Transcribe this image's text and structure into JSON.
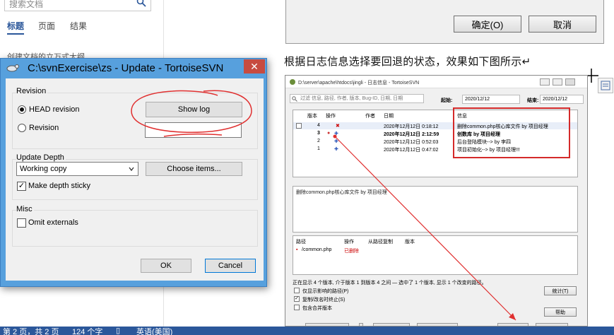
{
  "nav": {
    "search_placeholder": "搜索文档",
    "tabs": [
      "标题",
      "页面",
      "结果"
    ],
    "outline_item": "创建文档的立万式大纲"
  },
  "doc": {
    "confirm_label": "确定(O)",
    "cancel_label": "取消",
    "body_text": "根据日志信息选择要回退的状态，效果如下图所示↵"
  },
  "logshot": {
    "title": "D:\\server\\apache\\htdocs\\jingli - 日志信息 - TortoiseSVN",
    "filter_placeholder": "过滤 信息, 路径, 作者, 版本, Bug-ID, 日期, 日期",
    "from_label": "起始:",
    "from_value": "2020/12/12",
    "to_label": "结束:",
    "to_value": "2020/12/12",
    "columns": [
      "版本",
      "操作",
      "作者",
      "日期",
      "信息"
    ],
    "rows": [
      {
        "rev": "4",
        "date": "2020年12月12日 0:18:12",
        "msg": "删除common.php核心库文件 by 项目经理",
        "bold": false
      },
      {
        "rev": "3",
        "date": "2020年12月12日 2:12:59",
        "msg": "创数库 by 项目经理",
        "bold": true
      },
      {
        "rev": "2",
        "date": "2020年12月12日 0:52:03",
        "msg": "后台登陆模块--> by 李四",
        "bold": false
      },
      {
        "rev": "1",
        "date": "2020年12月12日 0:47:02",
        "msg": "项目初始化--> by 项目经理!!!",
        "bold": false
      }
    ],
    "detail_text": "删除common.php核心库文件  by  项目经理",
    "path_columns": [
      "路径",
      "操作",
      "从路径复制",
      "版本"
    ],
    "path_row": {
      "path": "/common.php",
      "action": "已删除"
    },
    "status_text": "正在显示 4 个版本, 介于版本 1 到版本 4 之间 — 选中了 1 个版本, 显示 1 个改变的路径。",
    "options": [
      "仅显示影响的路径(P)",
      "复制/改名时终止(S)",
      "包含合并版本"
    ],
    "stats_label": "统计(T)",
    "help_label": "帮助"
  },
  "dialog": {
    "title": "C:\\svnExercise\\zs - Update - TortoiseSVN",
    "close_glyph": "✕",
    "revision_group": "Revision",
    "head_revision": "HEAD revision",
    "revision": "Revision",
    "show_log": "Show log",
    "update_depth_group": "Update Depth",
    "depth_value": "Working copy",
    "choose_items": "Choose items...",
    "make_depth_sticky": "Make depth sticky",
    "misc_group": "Misc",
    "omit_externals": "Omit externals",
    "ok": "OK",
    "cancel": "Cancel"
  },
  "status": {
    "page": "第 2 页，共 2 页",
    "words": "124 个字",
    "language": "英语(美国)"
  },
  "colors": {
    "dialog_frame": "#57a0dd",
    "close_red": "#c74b40",
    "annotation_red": "#d42a2a",
    "status_bar": "#2b579a"
  }
}
